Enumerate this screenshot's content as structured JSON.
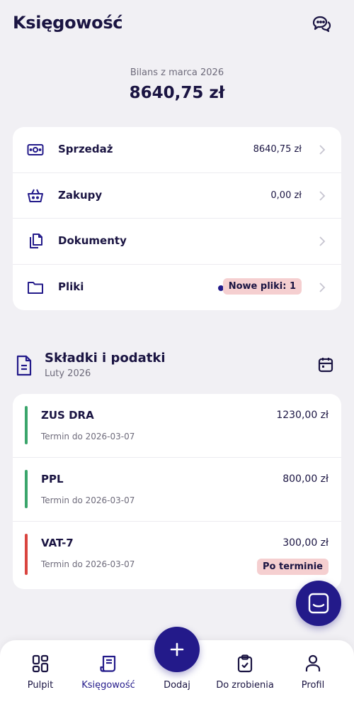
{
  "header": {
    "title": "Księgowość",
    "chat_icon": "chat-bubbles-icon"
  },
  "balance": {
    "label": "Bilans z marca 2026",
    "value": "8640,75 zł"
  },
  "menu": [
    {
      "label": "Sprzedaż",
      "value": "8640,75 zł",
      "icon": "cash-icon"
    },
    {
      "label": "Zakupy",
      "value": "0,00 zł",
      "icon": "basket-icon"
    },
    {
      "label": "Dokumenty",
      "value": "",
      "icon": "documents-icon"
    },
    {
      "label": "Pliki",
      "value": "",
      "badge": "Nowe pliki: 1",
      "icon": "folder-icon"
    }
  ],
  "taxes": {
    "title": "Składki i podatki",
    "subtitle": "Luty 2026",
    "items": [
      {
        "name": "ZUS DRA",
        "amount": "1230,00 zł",
        "due": "Termin do 2026-03-07",
        "color": "#3aa56b"
      },
      {
        "name": "PPL",
        "amount": "800,00 zł",
        "due": "Termin do 2026-03-07",
        "color": "#3aa56b"
      },
      {
        "name": "VAT-7",
        "amount": "300,00 zł",
        "due": "Termin do 2026-03-07",
        "color": "#d9443f",
        "badge": "Po terminie"
      }
    ]
  },
  "nav": {
    "items": [
      {
        "label": "Pulpit",
        "icon": "dashboard-icon"
      },
      {
        "label": "Księgowość",
        "icon": "receipt-icon",
        "active": true
      },
      {
        "label": "Dodaj",
        "icon": "plus-icon"
      },
      {
        "label": "Do zrobienia",
        "icon": "clipboard-check-icon"
      },
      {
        "label": "Profil",
        "icon": "user-icon"
      }
    ]
  },
  "colors": {
    "accent": "#231a8a",
    "background": "#f1f0f4",
    "badge": "#f5cfd0"
  }
}
